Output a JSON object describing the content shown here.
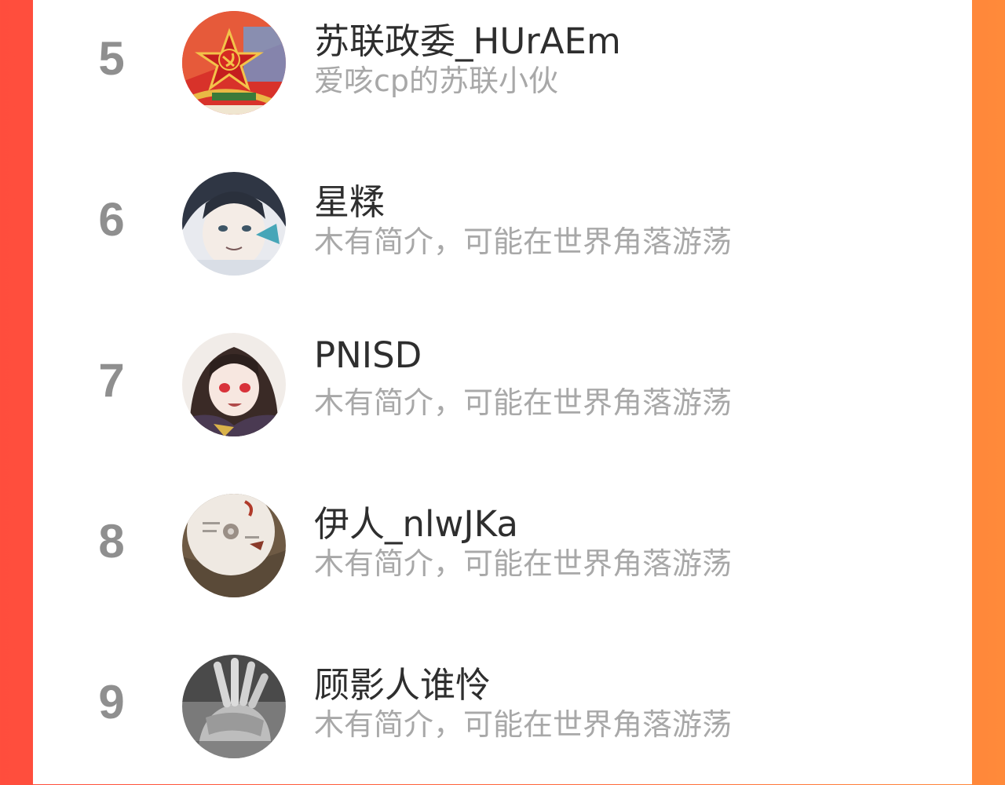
{
  "list": {
    "items": [
      {
        "rank": "5",
        "name": "苏联政委_HUrAEm",
        "bio": "爱咳cp的苏联小伙",
        "avatar_icon": "soviet-star-avatar"
      },
      {
        "rank": "6",
        "name": "星糅",
        "bio": "木有简介，可能在世界角落游荡",
        "avatar_icon": "anime-girl-avatar"
      },
      {
        "rank": "7",
        "name": "PNISD",
        "bio": "木有简介，可能在世界角落游荡",
        "avatar_icon": "red-eyed-anime-avatar"
      },
      {
        "rank": "8",
        "name": "伊人_nlwJKa",
        "bio": "木有简介，可能在世界角落游荡",
        "avatar_icon": "disc-photo-avatar"
      },
      {
        "rank": "9",
        "name": "顾影人谁怜",
        "bio": "木有简介，可能在世界角落游荡",
        "avatar_icon": "grayscale-hand-avatar"
      }
    ]
  },
  "colors": {
    "background_left": "#ff4d3d",
    "background_right": "#ff8a3a",
    "rank_text": "#8f8f8f",
    "name_text": "#2e2e2e",
    "bio_text": "#a8a8a8"
  }
}
